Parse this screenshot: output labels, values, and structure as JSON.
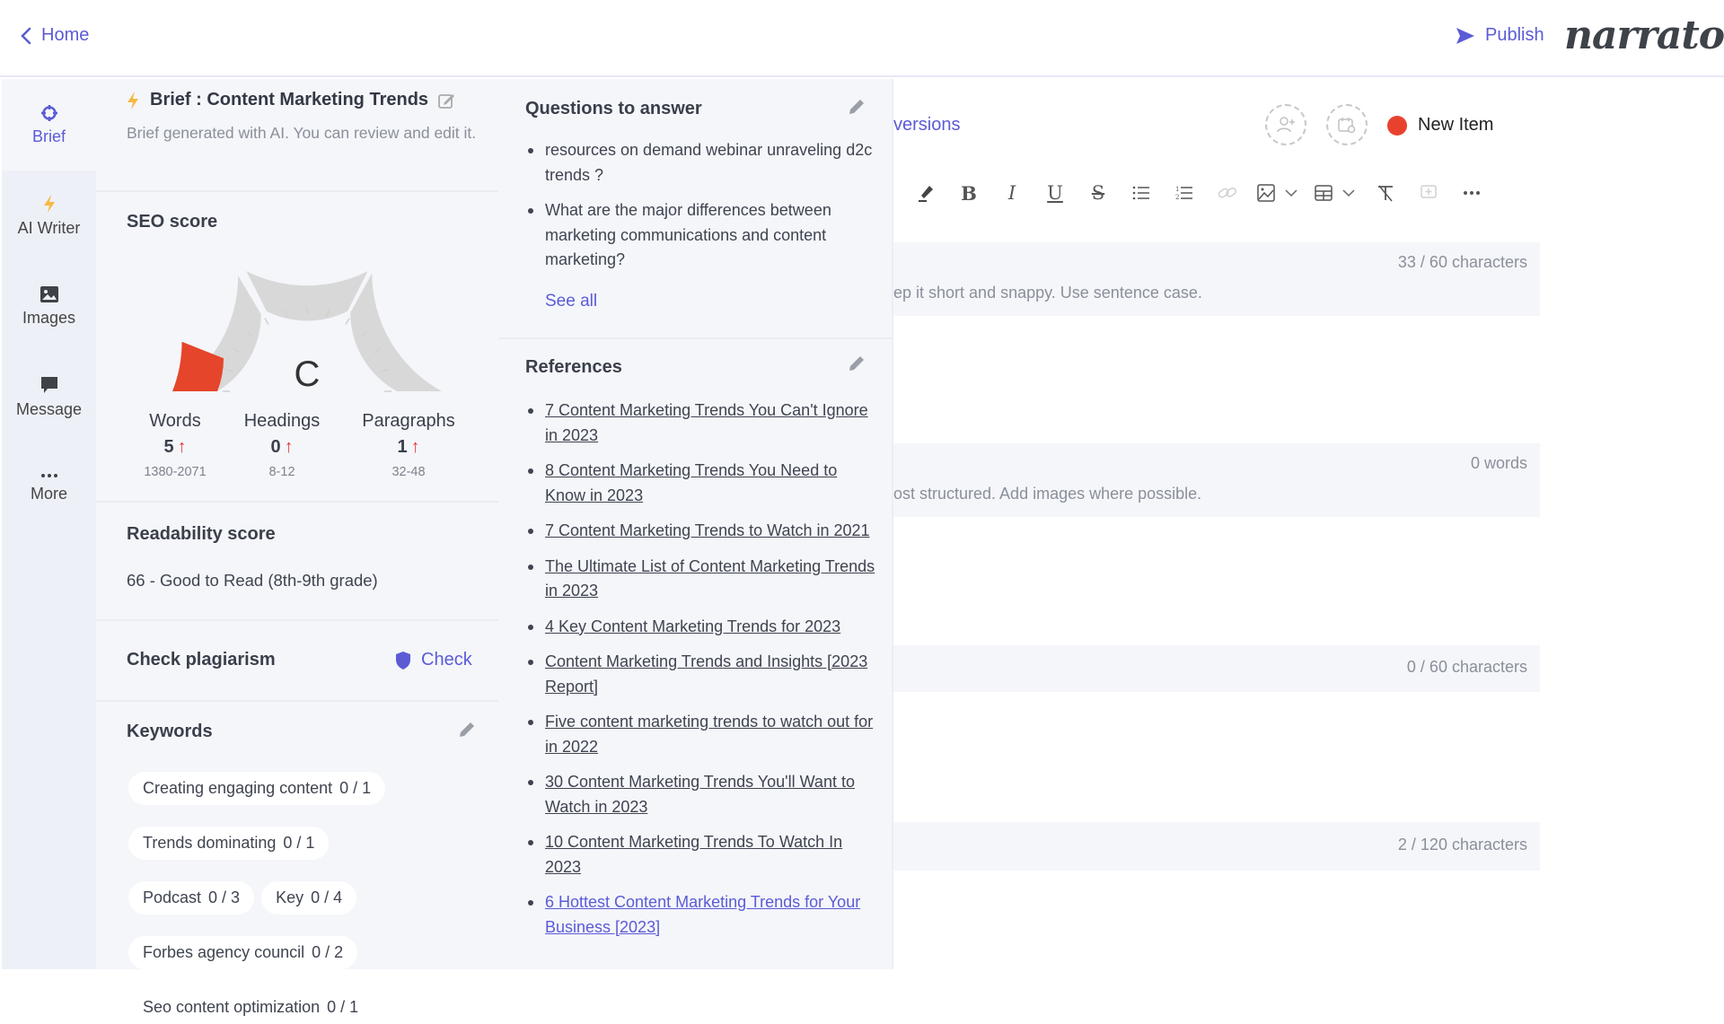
{
  "topbar": {
    "home_label": "Home",
    "publish_label": "Publish",
    "logo": "narrato",
    "accent": "#5b5bd6"
  },
  "sidebar": {
    "items": [
      {
        "label": "Brief",
        "icon": "crosshair-icon",
        "active": true
      },
      {
        "label": "AI Writer",
        "icon": "lightning-icon"
      },
      {
        "label": "Images",
        "icon": "image-icon"
      },
      {
        "label": "Message",
        "icon": "message-icon"
      },
      {
        "label": "More",
        "icon": "more-dots-icon"
      }
    ]
  },
  "brief": {
    "title": "Brief : Content Marketing Trends",
    "subtitle": "Brief generated with AI. You can review and edit it.",
    "seo": {
      "title": "SEO score",
      "grade": "C",
      "score_fraction": 0.12,
      "metrics": [
        {
          "label": "Words",
          "value": "5",
          "range": "1380-2071",
          "trend": "up"
        },
        {
          "label": "Headings",
          "value": "0",
          "range": "8-12",
          "trend": "up"
        },
        {
          "label": "Paragraphs",
          "value": "1",
          "range": "32-48",
          "trend": "up"
        }
      ]
    },
    "readability": {
      "title": "Readability score",
      "value": "66 - Good to Read (8th-9th grade)"
    },
    "plagiarism": {
      "title": "Check plagiarism",
      "button": "Check"
    },
    "keywords": {
      "title": "Keywords",
      "items": [
        {
          "term": "Creating engaging content",
          "count": "0 / 1"
        },
        {
          "term": "Trends dominating",
          "count": "0 / 1"
        },
        {
          "term": "Podcast",
          "count": "0 / 3"
        },
        {
          "term": "Key",
          "count": "0 / 4"
        },
        {
          "term": "Forbes agency council",
          "count": "0 / 2"
        },
        {
          "term": "Seo content optimization",
          "count": "0 / 1"
        }
      ]
    }
  },
  "questions": {
    "title": "Questions to answer",
    "items": [
      "resources on demand webinar unraveling d2c trends ?",
      "What are the major differences between marketing communications and content marketing?"
    ],
    "see_all": "See all"
  },
  "references": {
    "title": "References",
    "items": [
      "7 Content Marketing Trends You Can't Ignore in 2023",
      "8 Content Marketing Trends You Need to Know in 2023",
      "7 Content Marketing Trends to Watch in 2021",
      "The Ultimate List of Content Marketing Trends in 2023",
      "4 Key Content Marketing Trends for 2023",
      "Content Marketing Trends and Insights [2023 Report]",
      "Five content marketing trends to watch out for in 2022",
      "30 Content Marketing Trends You'll Want to Watch in 2023",
      "10 Content Marketing Trends To Watch In 2023",
      "6 Hottest Content Marketing Trends for Your Business [2023]"
    ]
  },
  "editor": {
    "versions_label": "versions",
    "status_label": "New Item",
    "status_color": "#e8422f",
    "toolbar": [
      "highlight",
      "bold",
      "italic",
      "underline",
      "strikethrough",
      "bullet-list",
      "numbered-list",
      "link",
      "image",
      "table",
      "clear-format",
      "comment",
      "more"
    ],
    "fields": [
      {
        "counter": "33 / 60 characters",
        "hint": "ep it short and snappy. Use sentence case."
      },
      {
        "counter": "0 words",
        "hint": "ost structured. Add images where possible."
      },
      {
        "counter": "0 / 60 characters",
        "hint": ""
      },
      {
        "counter": "2 / 120 characters",
        "hint": ""
      }
    ]
  }
}
